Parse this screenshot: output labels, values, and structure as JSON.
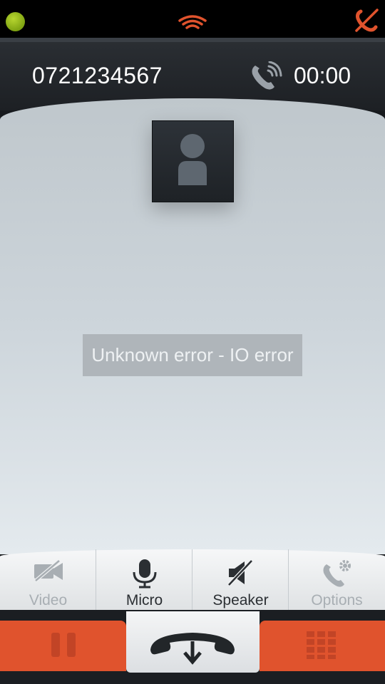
{
  "status_bar": {
    "left_indicator": "green-dot",
    "center_icon": "signal-waves-icon",
    "right_icon": "no-connection-icon"
  },
  "call": {
    "number": "0721234567",
    "duration": "00:00",
    "status_icon": "call-in-progress-icon"
  },
  "contact": {
    "avatar": "contact-avatar-icon"
  },
  "message": {
    "text": "Unknown error - IO error"
  },
  "controls": [
    {
      "label": "Video",
      "icon": "video-off-icon",
      "enabled": false
    },
    {
      "label": "Micro",
      "icon": "microphone-icon",
      "enabled": true
    },
    {
      "label": "Speaker",
      "icon": "speaker-off-icon",
      "enabled": true
    },
    {
      "label": "Options",
      "icon": "phone-gear-icon",
      "enabled": false
    }
  ],
  "actions": {
    "left": {
      "icon": "pause-icon"
    },
    "center": {
      "icon": "hang-up-icon"
    },
    "right": {
      "icon": "dialpad-icon"
    }
  },
  "colors": {
    "accent": "#e0532d",
    "header_bg": "#1d2024",
    "content_bg": "#cdd5db",
    "status_dot": "#8db21a"
  }
}
